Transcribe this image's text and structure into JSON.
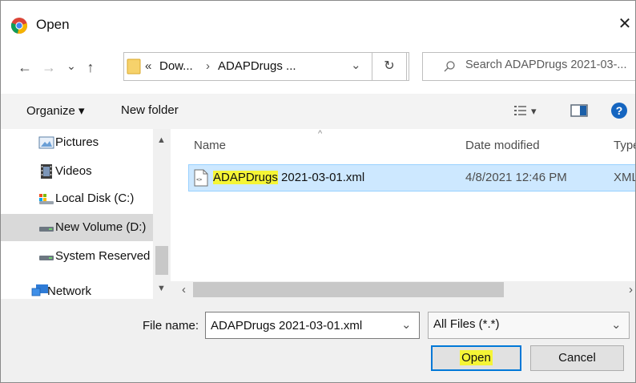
{
  "window": {
    "title": "Open",
    "close_glyph": "✕"
  },
  "nav": {
    "back": "←",
    "forward": "→",
    "recent": "⌄",
    "up": "↑",
    "breadcrumb": {
      "overflow": "«",
      "seg1": "Dow...",
      "sep": "›",
      "seg2": "ADAPDrugs ..."
    },
    "dropdown": "⌄",
    "refresh": "↻",
    "search_placeholder": "Search ADAPDrugs 2021-03-..."
  },
  "toolbar": {
    "organize": "Organize ▾",
    "new_folder": "New folder",
    "view_glyph": "▾",
    "help": "?"
  },
  "sidebar": {
    "items": [
      {
        "label": "Pictures",
        "icon": "pictures-icon"
      },
      {
        "label": "Videos",
        "icon": "videos-icon"
      },
      {
        "label": "Local Disk (C:)",
        "icon": "local-disk-icon"
      },
      {
        "label": "New Volume (D:)",
        "icon": "drive-icon",
        "selected": true
      },
      {
        "label": "System Reserved",
        "icon": "drive-icon"
      },
      {
        "label": "Network",
        "icon": "network-icon"
      }
    ]
  },
  "columns": {
    "name": "Name",
    "date": "Date modified",
    "type": "Type"
  },
  "files": [
    {
      "name_part1": "ADAPDrugs",
      "name_part2": " 2021-03-01.xml",
      "date": "4/8/2021 12:46 PM",
      "type": "XML"
    }
  ],
  "footer": {
    "file_name_label": "File name:",
    "file_name_value": "ADAPDrugs 2021-03-01.xml",
    "file_type_value": "All Files (*.*)",
    "open": "Open",
    "cancel": "Cancel"
  },
  "colors": {
    "highlight": "#f5f536",
    "selection": "#cde8ff",
    "accent": "#0078d7"
  }
}
